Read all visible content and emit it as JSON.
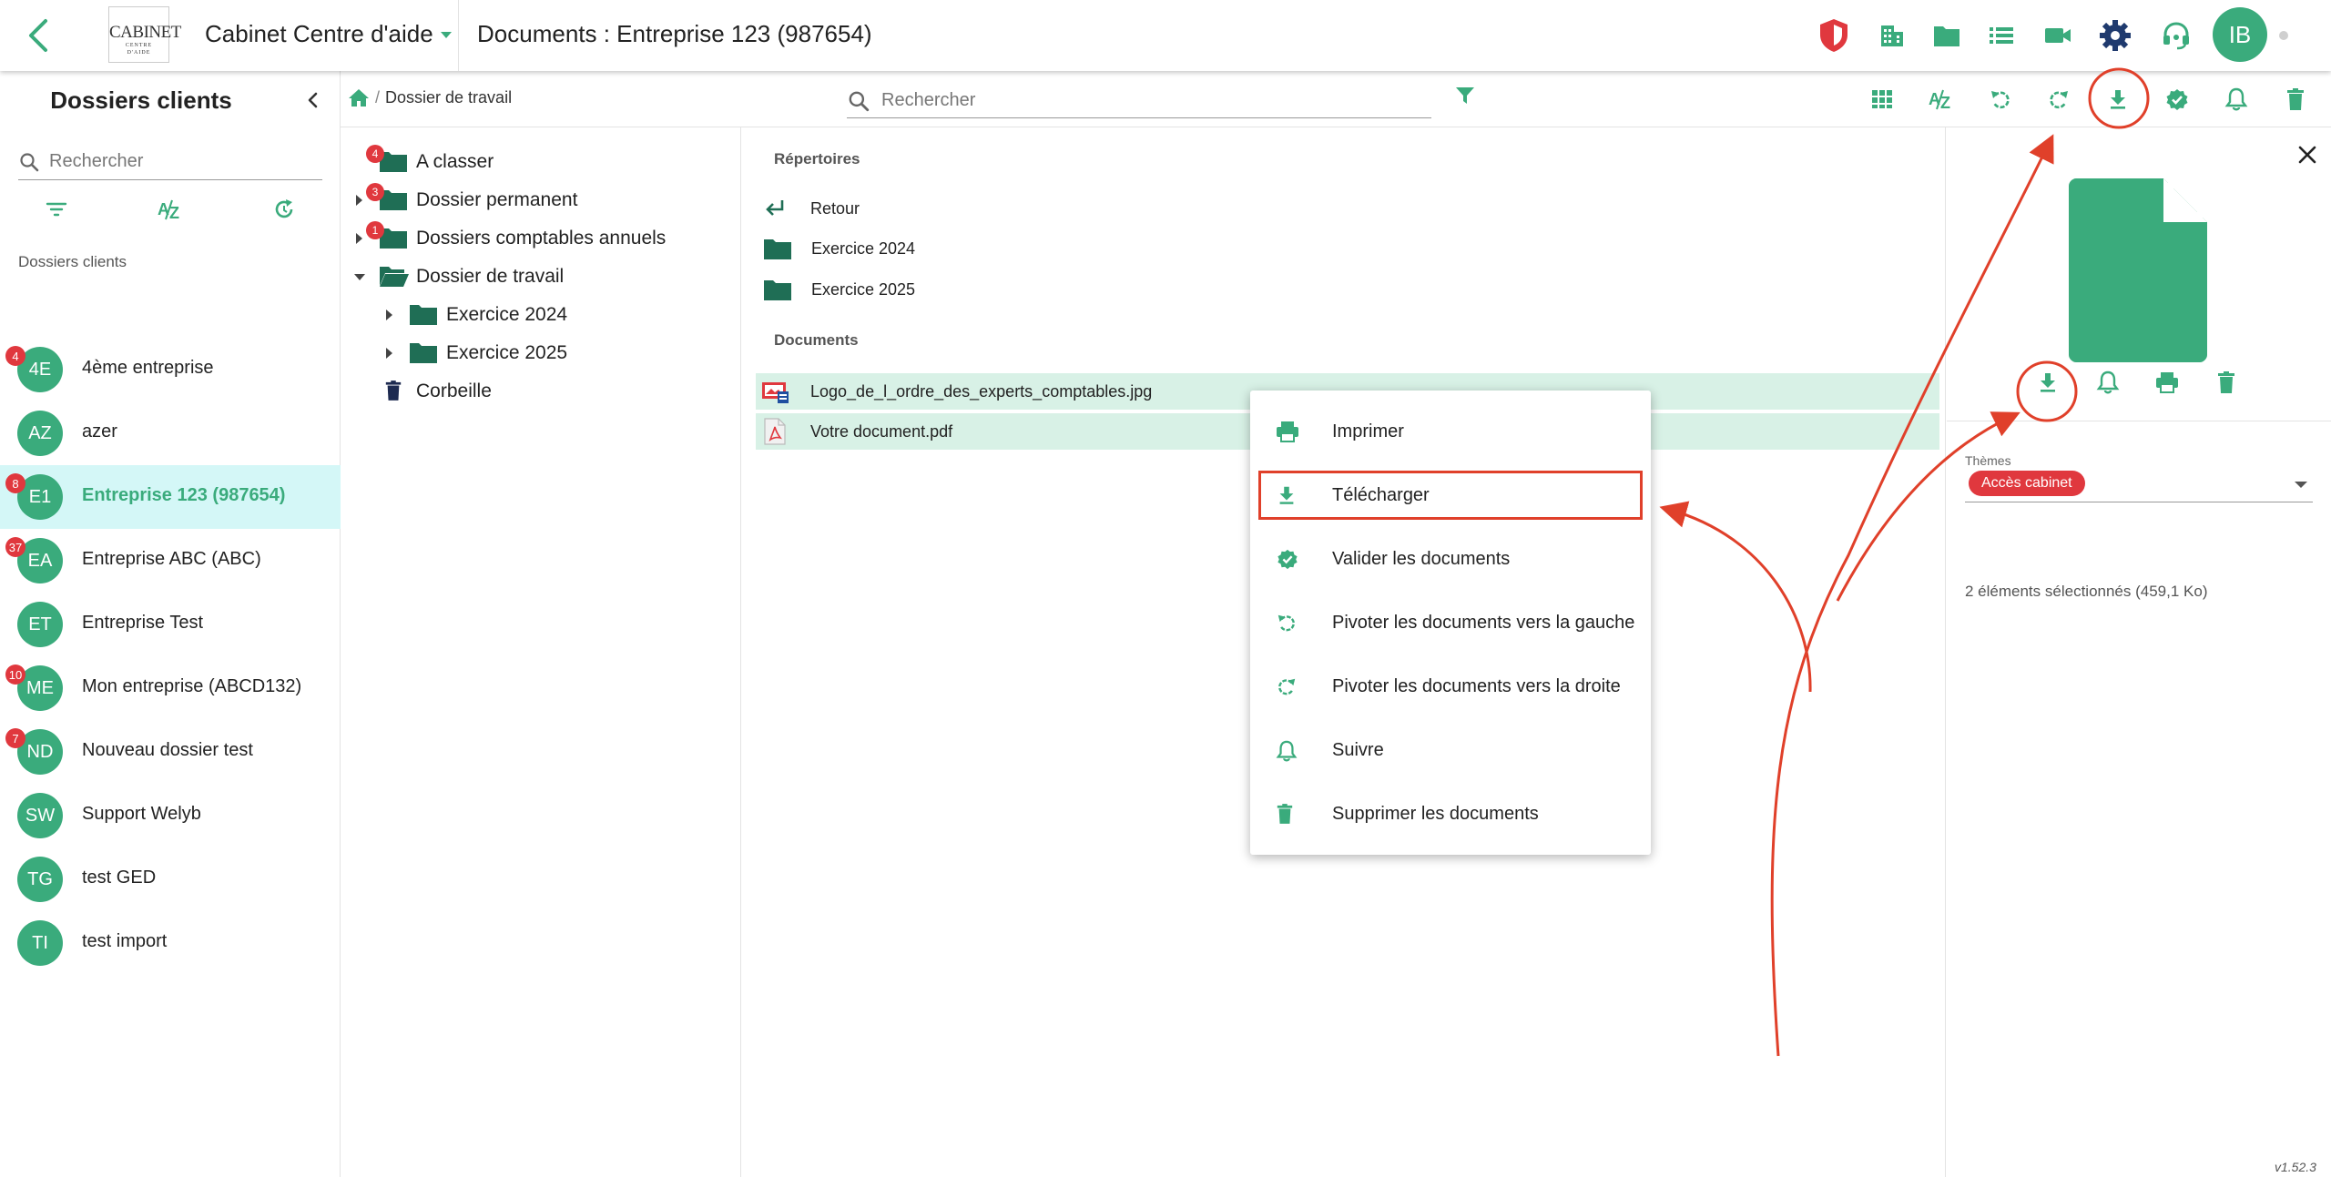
{
  "header": {
    "logo_line1": "CABINET",
    "logo_line2": "CENTRE",
    "logo_line3": "D'AIDE",
    "cabinet_name": "Cabinet Centre d'aide",
    "page_title": "Documents : Entreprise 123 (987654)",
    "user_initials": "IB"
  },
  "sidebar": {
    "title": "Dossiers clients",
    "search_placeholder": "Rechercher",
    "section_label": "Dossiers clients",
    "clients": [
      {
        "initials": "4E",
        "name": "4ème entreprise",
        "badge": "4",
        "selected": false
      },
      {
        "initials": "AZ",
        "name": "azer",
        "badge": "",
        "selected": false
      },
      {
        "initials": "E1",
        "name": "Entreprise 123 (987654)",
        "badge": "8",
        "selected": true
      },
      {
        "initials": "EA",
        "name": "Entreprise ABC (ABC)",
        "badge": "37",
        "selected": false
      },
      {
        "initials": "ET",
        "name": "Entreprise Test",
        "badge": "",
        "selected": false
      },
      {
        "initials": "ME",
        "name": "Mon entreprise (ABCD132)",
        "badge": "10",
        "selected": false
      },
      {
        "initials": "ND",
        "name": "Nouveau dossier test",
        "badge": "7",
        "selected": false
      },
      {
        "initials": "SW",
        "name": "Support Welyb",
        "badge": "",
        "selected": false
      },
      {
        "initials": "TG",
        "name": "test GED",
        "badge": "",
        "selected": false
      },
      {
        "initials": "TI",
        "name": "test import",
        "badge": "",
        "selected": false
      }
    ]
  },
  "toolbar": {
    "breadcrumb_current": "Dossier de travail",
    "search_placeholder": "Rechercher"
  },
  "tree": {
    "a_classer": {
      "label": "A classer",
      "badge": "4"
    },
    "dossier_permanent": {
      "label": "Dossier permanent",
      "badge": "3"
    },
    "dossiers_comptables": {
      "label": "Dossiers comptables annuels",
      "badge": "1"
    },
    "dossier_travail": {
      "label": "Dossier de travail"
    },
    "exercice_2024": {
      "label": "Exercice 2024"
    },
    "exercice_2025": {
      "label": "Exercice 2025"
    },
    "corbeille": {
      "label": "Corbeille"
    }
  },
  "listing": {
    "directories_header": "Répertoires",
    "back_label": "Retour",
    "directories": [
      "Exercice 2024",
      "Exercice 2025"
    ],
    "documents_header": "Documents",
    "documents": [
      "Logo_de_l_ordre_des_experts_comptables.jpg",
      "Votre document.pdf"
    ]
  },
  "context_menu": {
    "print": "Imprimer",
    "download": "Télécharger",
    "validate": "Valider les documents",
    "rotate_left": "Pivoter les documents vers la gauche",
    "rotate_right": "Pivoter les documents vers la droite",
    "follow": "Suivre",
    "delete": "Supprimer les documents"
  },
  "details": {
    "themes_label": "Thèmes",
    "theme_chip": "Accès cabinet",
    "selection_summary": "2 éléments sélectionnés (459,1 Ko)"
  },
  "version": "v1.52.3",
  "colors": {
    "accent": "#3aab7c",
    "dark_folder": "#1f6e55",
    "badge_red": "#e0383e",
    "annotation_red": "#e0402a",
    "selection_bg": "#d8f1e6",
    "client_selected_bg": "#d4f7f7",
    "navy": "#1f3a6e"
  }
}
